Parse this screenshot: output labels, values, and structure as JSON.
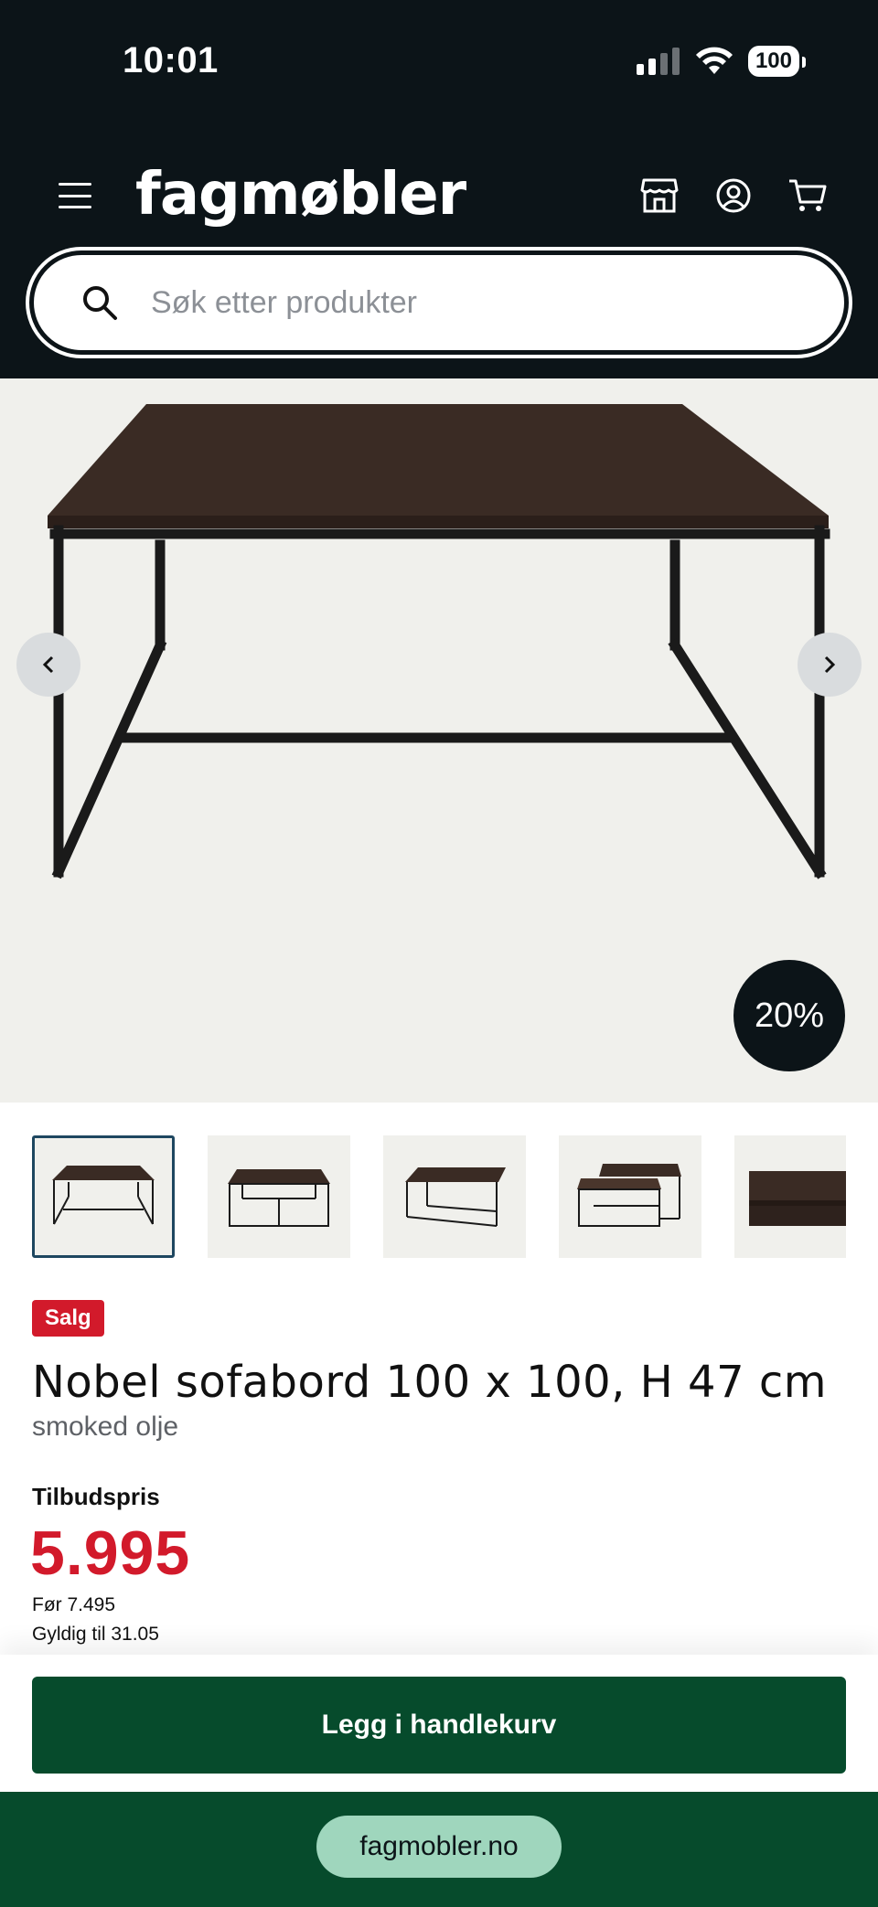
{
  "status": {
    "time": "10:01",
    "battery": "100"
  },
  "header": {
    "logo": "fagmøbler"
  },
  "search": {
    "placeholder": "Søk etter produkter"
  },
  "hero": {
    "discount": "20%"
  },
  "product": {
    "badge": "Salg",
    "title": "Nobel sofabord 100 x 100, H 47 cm",
    "subtitle": "smoked olje",
    "price_label": "Tilbudspris",
    "price": "5.995",
    "before": "Før 7.495",
    "valid": "Gyldig til 31.05"
  },
  "cart": {
    "button": "Legg i handlekurv"
  },
  "browser": {
    "url": "fagmobler.no"
  },
  "colors": {
    "header_bg": "#0c1418",
    "sale_red": "#d21a2b",
    "cart_green": "#064b2c",
    "pill_mint": "#9fd6bd"
  },
  "icons": [
    "signal-icon",
    "wifi-icon",
    "menu-icon",
    "store-icon",
    "account-icon",
    "cart-icon",
    "search-icon",
    "chevron-left-icon",
    "chevron-right-icon"
  ]
}
